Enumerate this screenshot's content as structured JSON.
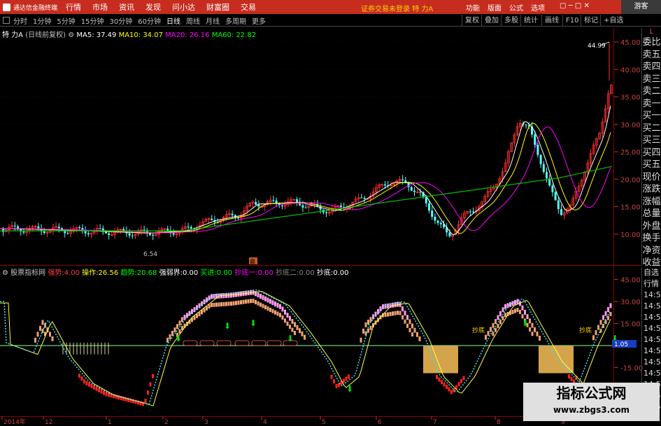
{
  "menubar": {
    "app_title": "通达信金融终端",
    "items": [
      "行情",
      "市场",
      "资讯",
      "发现",
      "问小达",
      "财富圈",
      "交易"
    ],
    "warning": "证券交易未登录",
    "stock": "特 力A",
    "right_items": [
      "功能",
      "版面",
      "公式",
      "选项"
    ],
    "guest": "游客"
  },
  "periods": {
    "items": [
      "分时",
      "1分钟",
      "5分钟",
      "15分钟",
      "30分钟",
      "60分钟",
      "日线",
      "周线",
      "月线",
      "多周期",
      "更多"
    ],
    "active": "日线"
  },
  "toolbar_right": {
    "items": [
      "复权",
      "叠加",
      "多股",
      "统计",
      "画线",
      "F10",
      "标记",
      "+自选"
    ]
  },
  "main_chart": {
    "title": "特 力A",
    "mode": "(日线前复权)",
    "ma": [
      {
        "label": "MA5: 37.49",
        "color": "#ffffff"
      },
      {
        "label": "MA10: 34.07",
        "color": "#ffff00"
      },
      {
        "label": "MA20: 26.16",
        "color": "#ff00ff"
      },
      {
        "label": "MA60: 22.82",
        "color": "#00ff00"
      }
    ],
    "y_ticks": [
      "45.00",
      "40.00",
      "35.00",
      "30.00",
      "25.00",
      "20.00",
      "15.00",
      "10.00"
    ],
    "high_label": "44.99",
    "low_label": "6.54",
    "marker": "晨"
  },
  "right_panel": {
    "items": [
      "委比",
      "卖五",
      "卖四",
      "卖三",
      "卖二",
      "卖一",
      "买一",
      "买二",
      "买三",
      "买四",
      "买五",
      "现价",
      "涨跌",
      "涨幅",
      "总量",
      "外盘",
      "换手",
      "净资",
      "收益"
    ],
    "top": "L"
  },
  "indicator": {
    "name": "股票指标网",
    "values": [
      {
        "label": "强势:",
        "value": "4.00",
        "color": "#ff4040"
      },
      {
        "label": "操作:",
        "value": "26.56",
        "color": "#ffff00"
      },
      {
        "label": "趋势:",
        "value": "20.68",
        "color": "#00ff00"
      },
      {
        "label": "强弱界:",
        "value": "0.00",
        "color": "#ffffff"
      },
      {
        "label": "买进:",
        "value": "0.00",
        "color": "#00ff00"
      },
      {
        "label": "抄底一:",
        "value": "0.00",
        "color": "#ff00ff"
      },
      {
        "label": "抄底二:",
        "value": "0.00",
        "color": "#888888"
      },
      {
        "label": "抄底:",
        "value": "0.00",
        "color": "#ffffff"
      }
    ],
    "y_ticks": [
      "45.00",
      "30.00",
      "15.00",
      "-15.00"
    ],
    "current": "1.05",
    "signal_labels": [
      "抄底",
      "抄底"
    ]
  },
  "right_panel2": {
    "items": [
      "自选",
      "行情",
      "14:5",
      "14:5",
      "14:5",
      "14:5",
      "14:5",
      "14:5",
      "14:5",
      "14:5",
      "14:5",
      "14:5",
      "14:5"
    ]
  },
  "x_axis": [
    "2014年",
    "12",
    "1",
    "2",
    "3",
    "4",
    "5",
    "6",
    "7",
    "8",
    "9"
  ],
  "watermark": {
    "line1": "指标公式网",
    "line2": "www.zbgs3.com"
  }
}
